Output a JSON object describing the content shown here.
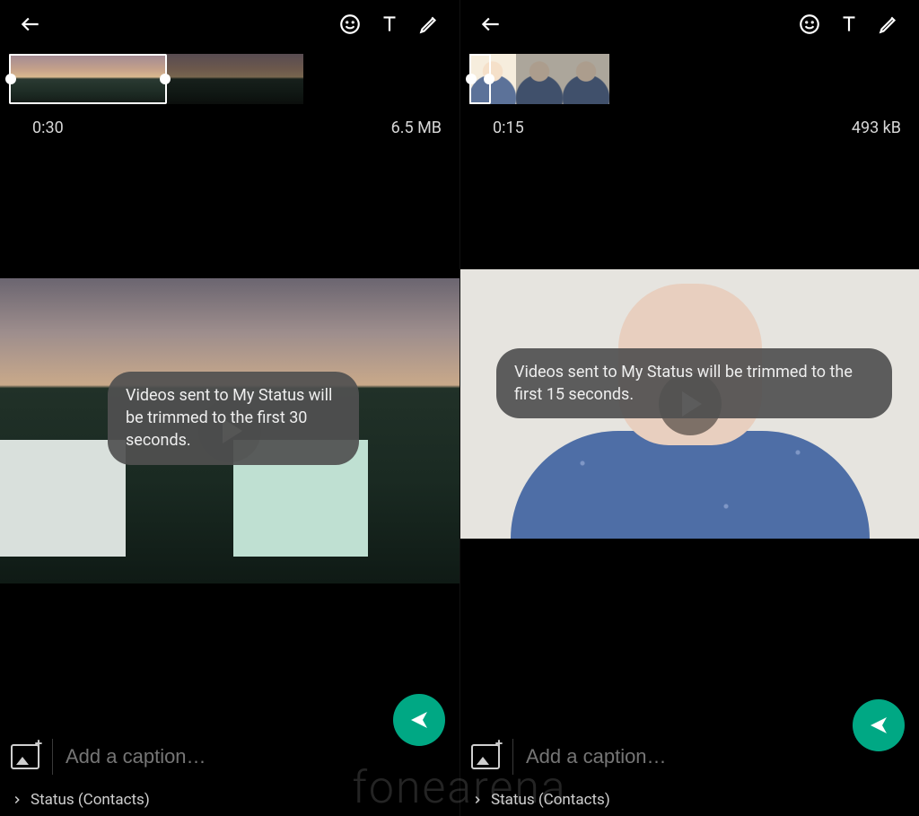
{
  "watermark": "fonearena",
  "left": {
    "caption_placeholder": "Add a caption…",
    "status_label": "Status (Contacts)",
    "toast": "Videos sent to My Status will be trimmed to the first 30 seconds.",
    "duration": "0:30",
    "size": "6.5 MB"
  },
  "right": {
    "caption_placeholder": "Add a caption…",
    "status_label": "Status (Contacts)",
    "toast": "Videos sent to My Status will be trimmed to the first 15 seconds.",
    "duration": "0:15",
    "size": "493 kB"
  }
}
